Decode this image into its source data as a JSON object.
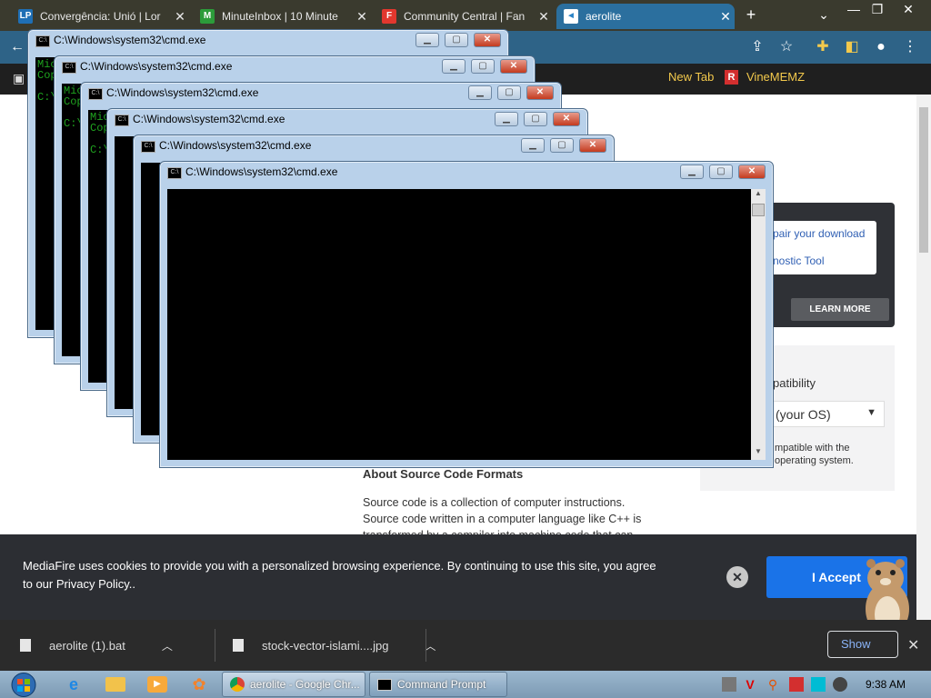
{
  "browser": {
    "tabs": [
      {
        "title": "Convergência: Unió | Lor",
        "favicon": "LP",
        "favicon_color": "#1f6fb5"
      },
      {
        "title": "MinuteInbox | 10 Minute",
        "favicon": "M",
        "favicon_color": "#2c9c3a"
      },
      {
        "title": "Community Central | Fan",
        "favicon": "F",
        "favicon_color": "#e2372e"
      },
      {
        "title": "aerolite",
        "favicon": "◄",
        "favicon_color": "#2b83c6"
      }
    ],
    "new_tab": "+",
    "bookmarks": [
      {
        "label": "New Tab"
      },
      {
        "label": "VineMEMZ",
        "icon": "R"
      }
    ]
  },
  "page": {
    "repair_link": "pair your download",
    "diag_link": "nostic Tool",
    "learn_more": "LEARN MORE",
    "compat_title": "patibility",
    "os_select": "(your OS)",
    "compat_note": "mpatible with the operating system.",
    "about_title": "About Source Code Formats",
    "about_text": "Source code is a collection of computer instructions. Source code written in a computer language like C++ is transformed by a compiler into machine code that can"
  },
  "cookie": {
    "text": "MediaFire uses cookies to provide you with a personalized browsing experience. By continuing to use this site, you agree to our Privacy Policy..",
    "accept": "I Accept",
    "close": "✕"
  },
  "downloads": {
    "items": [
      {
        "name": "aerolite (1).bat"
      },
      {
        "name": "stock-vector-islami....jpg"
      }
    ],
    "show_all": "Show"
  },
  "cmd": {
    "title": "C:\\Windows\\system32\\cmd.exe",
    "console_snippets": [
      "Mic\nCop\n\nC:\\",
      "Mic\nCop\n\nC:\\",
      "Mic\nCop\n\nC:\\se",
      "",
      "",
      ""
    ]
  },
  "taskbar": {
    "chrome_button": "aerolite - Google Chr...",
    "cmd_button": "Command Prompt",
    "clock": "9:38 AM"
  }
}
